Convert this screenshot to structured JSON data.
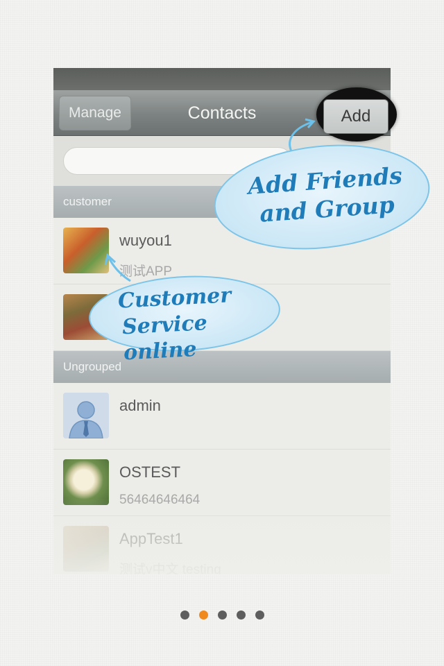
{
  "nav": {
    "manage_label": "Manage",
    "title": "Contacts",
    "add_label": "Add"
  },
  "search": {
    "placeholder": ""
  },
  "groups": [
    {
      "label": "customer",
      "contacts": [
        {
          "name": "wuyou1",
          "subtitle": "测试APP",
          "avatar_icon": "photo-avatar"
        },
        {
          "name": "",
          "subtitle": "",
          "avatar_icon": "photo-avatar"
        }
      ]
    },
    {
      "label": "Ungrouped",
      "contacts": [
        {
          "name": "admin",
          "subtitle": "",
          "avatar_icon": "default-user-avatar"
        },
        {
          "name": "OSTEST",
          "subtitle": "56464646464",
          "avatar_icon": "flower-avatar"
        },
        {
          "name": "AppTest1",
          "subtitle": "测试v中文 testing",
          "avatar_icon": "photo-avatar"
        }
      ]
    }
  ],
  "callouts": {
    "add": {
      "line1": "Add Friends",
      "line2": "and Group"
    },
    "customer": {
      "line1": "Customer",
      "line2": "Service online"
    }
  },
  "pagination": {
    "total": 5,
    "active_index": 1
  },
  "colors": {
    "accent_dot": "#f08a1e",
    "callout_text": "#1f7cb8",
    "callout_border": "#7cc4e8"
  }
}
